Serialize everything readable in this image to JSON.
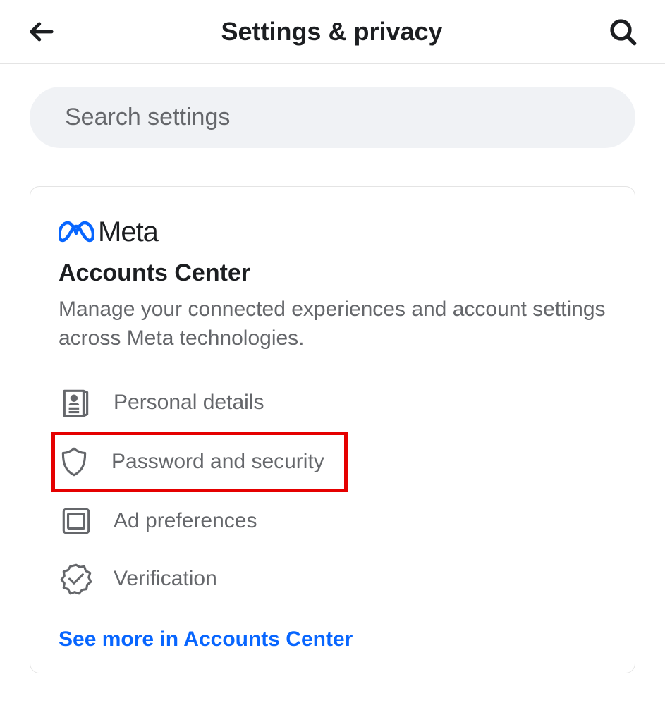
{
  "header": {
    "title": "Settings & privacy"
  },
  "search": {
    "placeholder": "Search settings"
  },
  "card": {
    "brand": "Meta",
    "title": "Accounts Center",
    "description": "Manage your connected experiences and account settings across Meta technologies.",
    "items": [
      {
        "label": "Personal details"
      },
      {
        "label": "Password and security"
      },
      {
        "label": "Ad preferences"
      },
      {
        "label": "Verification"
      }
    ],
    "see_more": "See more in Accounts Center"
  }
}
